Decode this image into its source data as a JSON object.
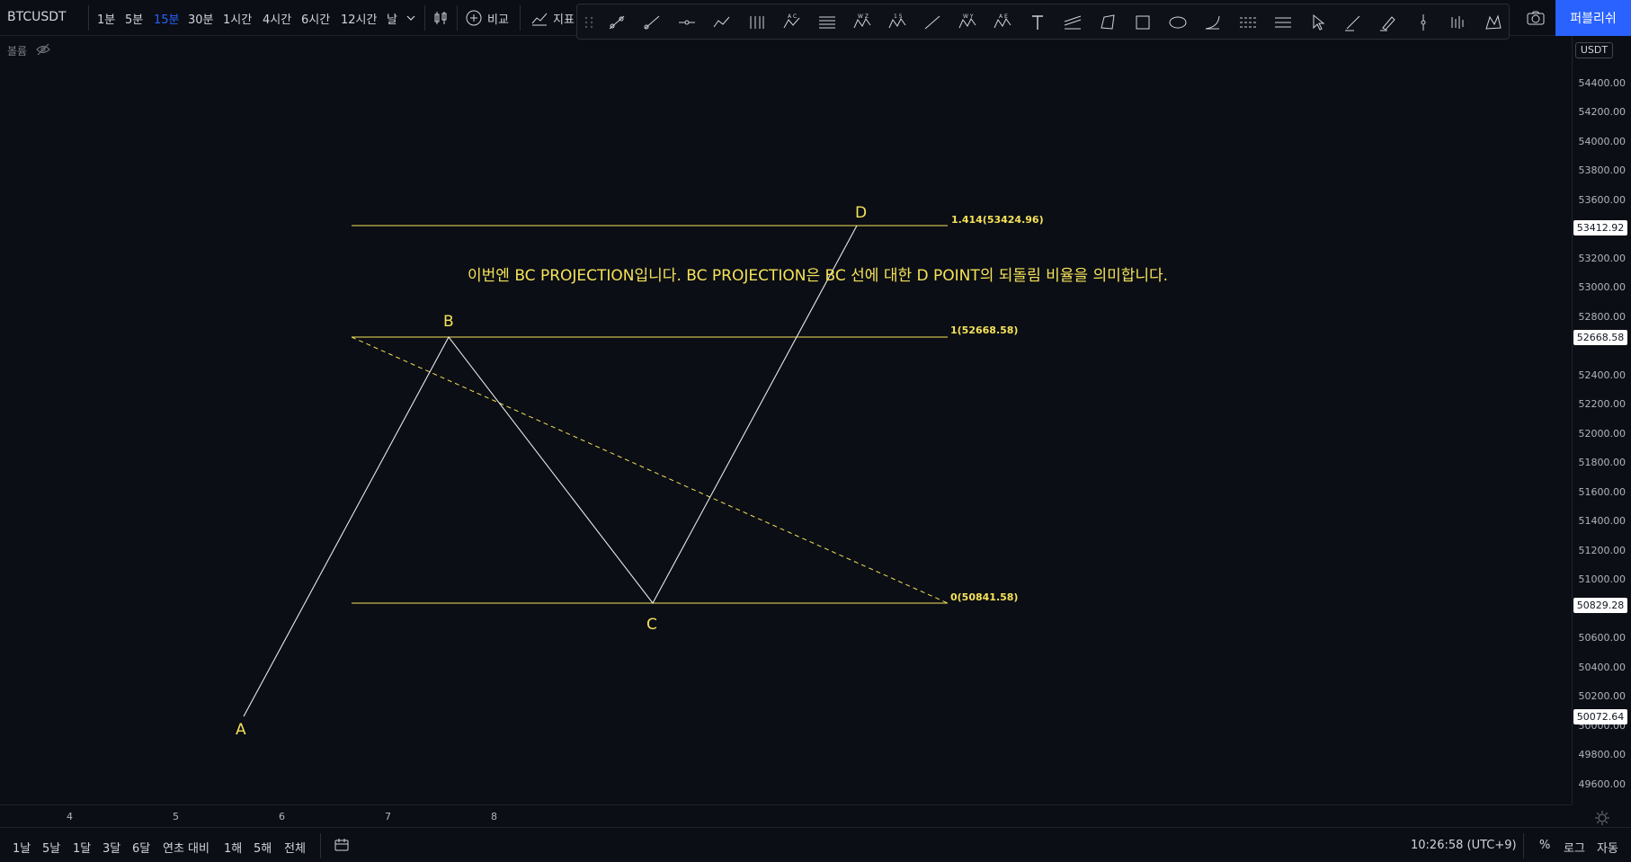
{
  "header": {
    "symbol": "BTCUSDT",
    "intervals": [
      "1분",
      "5분",
      "15분",
      "30분",
      "1시간",
      "4시간",
      "6시간",
      "12시간",
      "날"
    ],
    "active_interval": "15분",
    "compare_label": "비교",
    "indicators_label": "지표",
    "publish_label": "퍼블리쉬"
  },
  "legend": {
    "volume_label": "볼륨"
  },
  "annotation": {
    "text": "이번엔 BC PROJECTION입니다. BC PROJECTION은 BC 선에 대한 D POINT의 되돌림 비율을 의미합니다.",
    "points": {
      "A": "A",
      "B": "B",
      "C": "C",
      "D": "D"
    },
    "levels": [
      {
        "label": "1.414(53424.96)",
        "price": 53424.96
      },
      {
        "label": "1(52668.58)",
        "price": 52668.58
      },
      {
        "label": "0(50841.58)",
        "price": 50841.58
      }
    ],
    "color": "#f5e25a"
  },
  "price_axis": {
    "currency": "USDT",
    "ticks": [
      "54400.00",
      "54200.00",
      "54000.00",
      "53800.00",
      "53600.00",
      "53200.00",
      "53000.00",
      "52800.00",
      "52400.00",
      "52200.00",
      "52000.00",
      "51800.00",
      "51600.00",
      "51400.00",
      "51200.00",
      "51000.00",
      "50600.00",
      "50400.00",
      "50200.00",
      "50000.00",
      "49800.00",
      "49600.00"
    ],
    "labels": [
      "53412.92",
      "52668.58",
      "50829.28",
      "50072.64"
    ]
  },
  "time_axis": {
    "ticks": [
      "4",
      "5",
      "6",
      "7",
      "8"
    ]
  },
  "bottom": {
    "ranges": [
      "1날",
      "5날",
      "1달",
      "3달",
      "6달",
      "연초 대비",
      "1해",
      "5해",
      "전체"
    ],
    "clock": "10:26:58 (UTC+9)",
    "percent_label": "%",
    "log_label": "로그",
    "auto_label": "자동"
  },
  "colors": {
    "accent": "#2962ff",
    "drawing": "#f5e25a",
    "background": "#0b0e14"
  }
}
